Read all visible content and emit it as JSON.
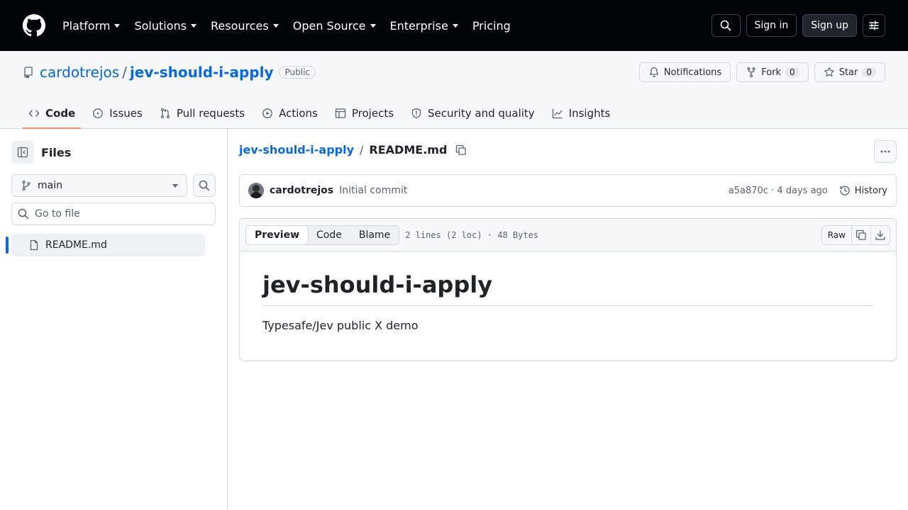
{
  "header": {
    "nav": [
      "Platform",
      "Solutions",
      "Resources",
      "Open Source",
      "Enterprise"
    ],
    "pricing": "Pricing",
    "sign_in": "Sign in",
    "sign_up": "Sign up"
  },
  "repo": {
    "owner": "cardotrejos",
    "separator": "/",
    "name": "jev-should-i-apply",
    "visibility": "Public",
    "notifications": "Notifications",
    "fork_label": "Fork",
    "fork_count": "0",
    "star_label": "Star",
    "star_count": "0"
  },
  "tabs": [
    {
      "label": "Code",
      "icon": "code-icon",
      "active": true
    },
    {
      "label": "Issues",
      "icon": "issue-icon"
    },
    {
      "label": "Pull requests",
      "icon": "pull-request-icon"
    },
    {
      "label": "Actions",
      "icon": "play-icon"
    },
    {
      "label": "Projects",
      "icon": "table-icon"
    },
    {
      "label": "Security and quality",
      "icon": "shield-icon"
    },
    {
      "label": "Insights",
      "icon": "graph-icon"
    }
  ],
  "sidebar": {
    "title": "Files",
    "branch": "main",
    "goto_placeholder": "Go to file",
    "files": [
      "README.md"
    ]
  },
  "breadcrumb": {
    "repo": "jev-should-i-apply",
    "sep": "/",
    "file": "README.md"
  },
  "commit": {
    "author": "cardotrejos",
    "message": "Initial commit",
    "meta": "a5a870c · 4 days ago",
    "history": "History"
  },
  "file": {
    "views": [
      "Preview",
      "Code",
      "Blame"
    ],
    "meta": "2 lines (2 loc) · 48 Bytes",
    "raw": "Raw"
  },
  "readme": {
    "heading": "jev-should-i-apply",
    "body": "Typesafe/Jev public X demo"
  },
  "colors": {
    "header_bg": "#010409",
    "link": "#0969da",
    "tab_underline": "#fd8c73"
  }
}
